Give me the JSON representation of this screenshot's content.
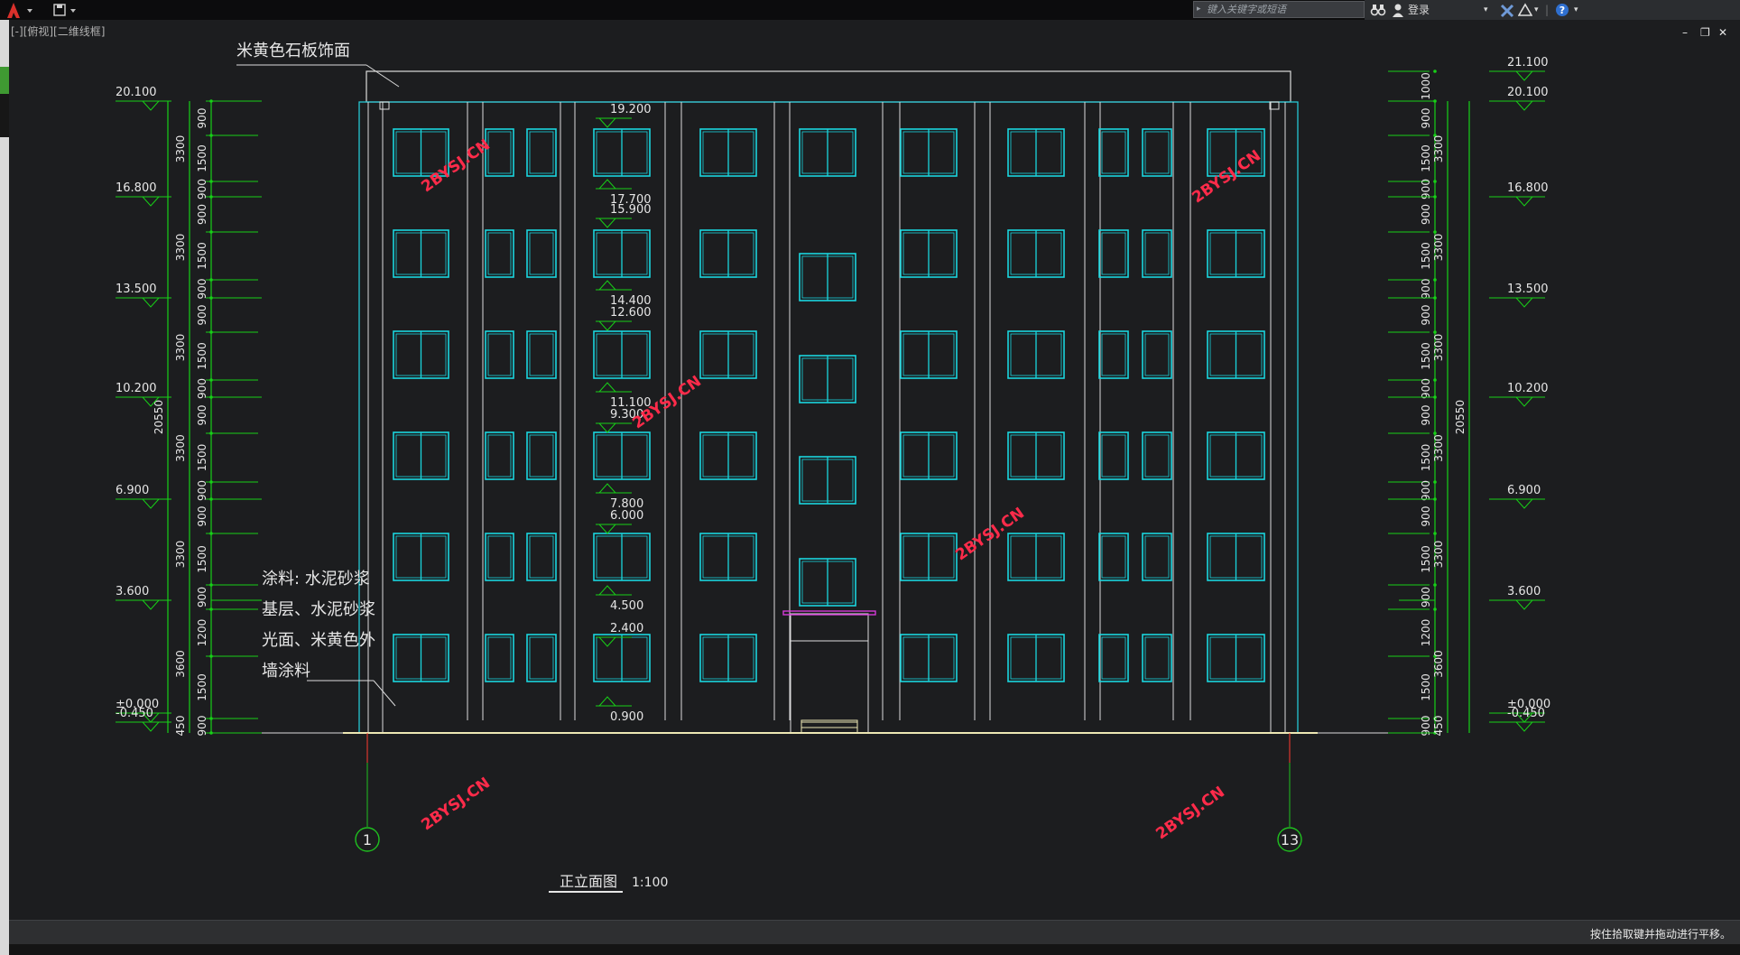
{
  "app": {
    "search_placeholder": "键入关键字或短语",
    "login_label": "登录",
    "help_label": "?",
    "viewport_label": "[-][俯视][二维线框]",
    "status_message": "按住拾取键并拖动进行平移。"
  },
  "drawing": {
    "facade_note": "米黄色石板饰面",
    "paint_note": [
      "涂料: 水泥砂浆",
      "基层、水泥砂浆",
      "光面、米黄色外",
      "墙涂料"
    ],
    "title": "正立面图",
    "scale": "1:100",
    "axis_left": "1",
    "axis_right": "13",
    "watermark": "2BYSJ.CN",
    "left_elevations": [
      "20.100",
      "16.800",
      "13.500",
      "10.200",
      "6.900",
      "3.600",
      "±0.000",
      "-0.450"
    ],
    "right_elevations": [
      "21.100",
      "20.100",
      "16.800",
      "13.500",
      "10.200",
      "6.900",
      "3.600",
      "±0.000",
      "-0.450"
    ],
    "center_elevations": [
      "19.200",
      "17.700",
      "15.900",
      "14.400",
      "12.600",
      "11.100",
      "9.300",
      "7.800",
      "6.000",
      "4.500",
      "2.400",
      "0.900"
    ],
    "left_floor_dims": [
      "3300",
      "3300",
      "3300",
      "3300",
      "3300",
      "3600",
      "450"
    ],
    "left_sub_dims": [
      "900",
      "1500",
      "900",
      "900",
      "1500",
      "900",
      "900",
      "1500",
      "900",
      "900",
      "1500",
      "900",
      "900",
      "1500",
      "900",
      "1200",
      "1500",
      "900"
    ],
    "right_floor_dims": [
      "3300",
      "3300",
      "3300",
      "3300",
      "3300",
      "3600",
      "450"
    ],
    "right_sub_dims": [
      "1000",
      "900",
      "1500",
      "900",
      "900",
      "1500",
      "900",
      "900",
      "1500",
      "900",
      "900",
      "1500",
      "900",
      "900",
      "1500",
      "900",
      "1200",
      "1500",
      "900"
    ],
    "total_height": "20550"
  },
  "colors": {
    "window": "#19d6de",
    "facade_line": "#dcdcdc",
    "building_outline": "#25c7d4",
    "dimension": "#17d017",
    "watermark": "#ff2b4a",
    "axis_circle": "#1fc11f",
    "ground": "#ede7b4"
  }
}
